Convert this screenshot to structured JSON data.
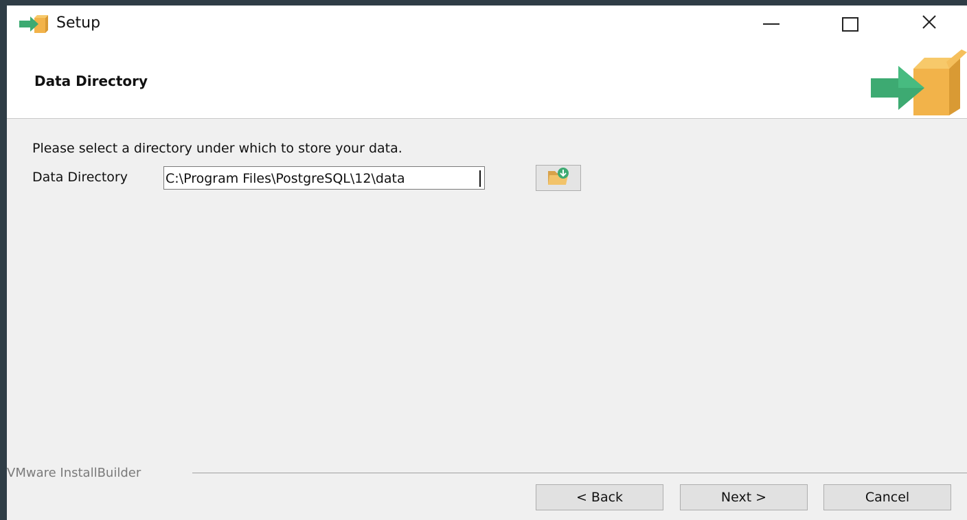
{
  "window": {
    "title": "Setup",
    "icon": "setup-box-arrow-icon",
    "controls": {
      "minimize": "minimize-icon",
      "maximize": "maximize-icon",
      "close": "close-icon"
    }
  },
  "header": {
    "title": "Data Directory",
    "icon": "setup-box-arrow-icon"
  },
  "content": {
    "prompt": "Please select a directory under which to store your data.",
    "field_label": "Data Directory",
    "field_value": "C:\\Program Files\\PostgreSQL\\12\\data",
    "browse_icon": "folder-browse-icon"
  },
  "footer": {
    "brand": "VMware InstallBuilder",
    "back_label": "< Back",
    "next_label": "Next >",
    "cancel_label": "Cancel"
  },
  "colors": {
    "desktop": "#2f3d46",
    "window_bg": "#f0f0f0",
    "arrow_green": "#3daa72",
    "box_orange": "#f2b34a"
  }
}
